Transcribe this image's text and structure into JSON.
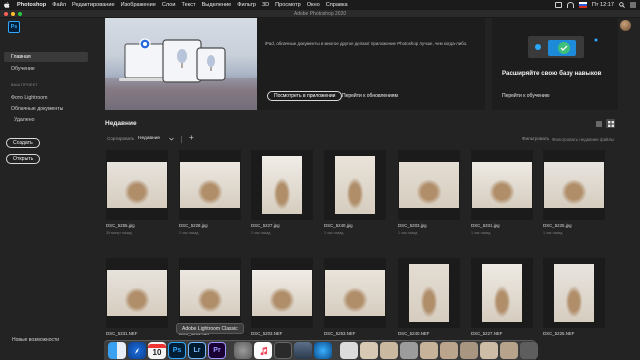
{
  "menubar": {
    "app_name": "Photoshop",
    "menus": [
      "Файл",
      "Редактирование",
      "Изображение",
      "Слои",
      "Текст",
      "Выделение",
      "Фильтр",
      "3D",
      "Просмотр",
      "Окно",
      "Справка"
    ],
    "clock": "Пт 12:17"
  },
  "window": {
    "title": "Adobe Photoshop 2020"
  },
  "header": {
    "logo": "Ps",
    "search_icon": "search-icon"
  },
  "sidebar": {
    "home": "Главная",
    "learn": "Обучение",
    "section": "ВАШ ПРОЕКТ",
    "lightroom": "Фото Lightroom",
    "cloud": "Облачные документы",
    "deleted": "Удалено",
    "create": "Создать",
    "open": "Открыть",
    "whats_new": "Новые возможности"
  },
  "hero": {
    "description": "iPad, облачные документы и многое другое делают приложение Photoshop лучше, чем когда-либо.",
    "button": "Посмотреть в приложении",
    "link": "Перейти к обновлениям"
  },
  "learn_card": {
    "title": "Расширяйте свою базу навыков",
    "link": "Перейти к обучению"
  },
  "recent": {
    "title": "Недавние",
    "sort_label": "Сортировать",
    "sort_value": "Недавние",
    "add": "+",
    "filter_label": "Фильтровать",
    "filter_placeholder": "Фильтровать недавние файлы",
    "row1": [
      {
        "name": "DSC_5255.jpg",
        "time": "39 минут назад"
      },
      {
        "name": "DSC_5228.jpg",
        "time": "1 час назад"
      },
      {
        "name": "DSC_5227.jpg",
        "time": "1 час назад"
      },
      {
        "name": "DSC_5240.jpg",
        "time": "1 час назад"
      },
      {
        "name": "DSC_5203.jpg",
        "time": "1 час назад"
      },
      {
        "name": "DSC_5331.jpg",
        "time": "1 час назад"
      },
      {
        "name": "DSC_5225.jpg",
        "time": "1 час назад"
      }
    ],
    "row2": [
      {
        "name": "DSC_5331.NEF",
        "time": ""
      },
      {
        "name": "DSC_5251.NEF",
        "time": ""
      },
      {
        "name": "DSC_5203.NEF",
        "time": ""
      },
      {
        "name": "DSC_5253.NEF",
        "time": ""
      },
      {
        "name": "DSC_5240.NEF",
        "time": ""
      },
      {
        "name": "DSC_5227.NEF",
        "time": ""
      },
      {
        "name": "DSC_5225.NEF",
        "time": ""
      }
    ]
  },
  "dock": {
    "tooltip": "Adobe Lightroom Classic",
    "calendar_day": "10",
    "ps": "Ps",
    "lr": "Lr",
    "pr": "Pr"
  },
  "colors": {
    "ps_blue": "#31a8ff",
    "lr_blue": "#74b8ff",
    "pr_purple": "#9999ff",
    "bg": "#232323"
  }
}
